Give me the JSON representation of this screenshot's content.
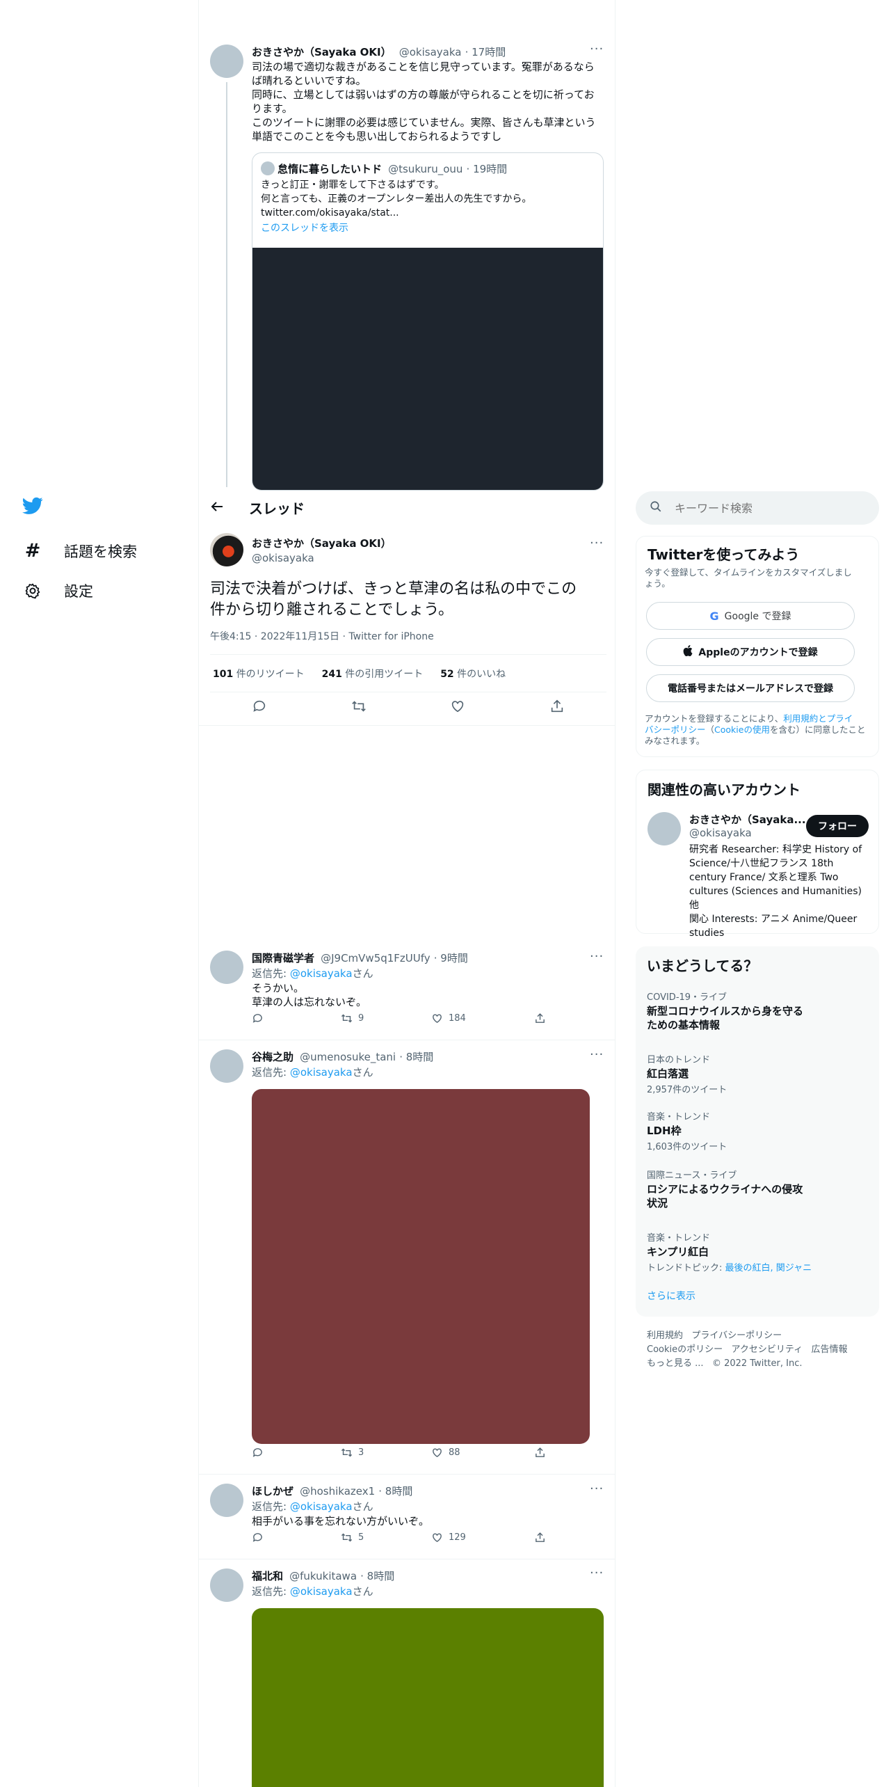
{
  "nav": {
    "explore_label": "話題を検索",
    "settings_label": "設定"
  },
  "top_tweet": {
    "name": "おきさやか（Sayaka OKI）",
    "handle": "@okisayaka",
    "time": "17時間",
    "lines": [
      "司法の場で適切な裁きがあることを信じ見守っています。冤罪があるなら",
      "ば晴れるといいですね。",
      "同時に、立場としては弱いはずの方の尊厳が守られることを切に祈ってお",
      "ります。",
      "このツイートに謝罪の必要は感じていません。実際、皆さんも草津という",
      "単語でこのことを今も思い出しておられるようですし"
    ],
    "quote": {
      "name": "怠惰に暮らしたいトド",
      "handle": "@tsukuru_ouu",
      "time": "19時間",
      "lines": [
        "きっと訂正・謝罪をして下さるはずです。",
        "何と言っても、正義のオープンレター差出人の先生ですから。",
        "twitter.com/okisayaka/stat..."
      ],
      "thread_link": "このスレッドを表示"
    }
  },
  "header": {
    "title": "スレッド"
  },
  "main_tweet": {
    "name": "おきさやか（Sayaka OKI）",
    "handle": "@okisayaka",
    "text_line1": "司法で決着がつけば、きっと草津の名は私の中でこの",
    "text_line2": "件から切り離されることでしょう。",
    "meta": "午後4:15 · 2022年11月15日 · Twitter for iPhone",
    "retweets": "101",
    "retweets_label": "件のリツイート",
    "quotes": "241",
    "quotes_label": "件の引用ツイート",
    "likes": "52",
    "likes_label": "件のいいね"
  },
  "replies": [
    {
      "name": "国際青磁学者",
      "handle": "@J9CmVw5q1FzUUfy",
      "time": "9時間",
      "reply_to": "返信先: ",
      "reply_handle": "@okisayaka",
      "reply_suffix": "さん",
      "line1": "そうかい。",
      "line2": "草津の人は忘れないぞ。",
      "retweets": "9",
      "likes": "184"
    },
    {
      "name": "谷梅之助",
      "handle": "@umenosuke_tani",
      "time": "8時間",
      "reply_to": "返信先: ",
      "reply_handle": "@okisayaka",
      "reply_suffix": "さん",
      "retweets": "3",
      "likes": "88"
    },
    {
      "name": "ほしかぜ",
      "handle": "@hoshikazex1",
      "time": "8時間",
      "reply_to": "返信先: ",
      "reply_handle": "@okisayaka",
      "reply_suffix": "さん",
      "line1": "相手がいる事を忘れない方がいいぞ。",
      "retweets": "5",
      "likes": "129"
    },
    {
      "name": "福北和",
      "handle": "@fukukitawa",
      "time": "8時間",
      "reply_to": "返信先: ",
      "reply_handle": "@okisayaka",
      "reply_suffix": "さん"
    }
  ],
  "search": {
    "placeholder": "キーワード検索"
  },
  "signup": {
    "title": "Twitterを使ってみよう",
    "subtitle_line1": "今すぐ登録して、タイムラインをカスタマイズしまし",
    "subtitle_line2": "ょう。",
    "google": "Google で登録",
    "apple": "Appleのアカウントで登録",
    "phone": "電話番号またはメールアドレスで登録",
    "terms_1": "アカウントを登録することにより、",
    "terms_link1": "利用規約とプライ",
    "terms_link2": "バシーポリシー",
    "terms_2": "（",
    "terms_link3": "Cookieの使用",
    "terms_3": "を含む）に同意したこと",
    "terms_4": "みなされます。"
  },
  "related": {
    "title": "関連性の高いアカウント",
    "name": "おきさやか（Sayaka...",
    "handle": "@okisayaka",
    "follow": "フォロー",
    "bio_lines": [
      "研究者 Researcher: 科学史 History of",
      "Science/十八世紀フランス 18th",
      "century France/ 文系と理系 Two",
      "cultures (Sciences and Humanities) 他",
      "関心 Interests: アニメ Anime/Queer",
      "studies"
    ]
  },
  "trends": {
    "title": "いまどうしてる？",
    "items": [
      {
        "meta": "COVID-19・ライブ",
        "name_line1": "新型コロナウイルスから身を守る",
        "name_line2": "ための基本情報"
      },
      {
        "meta": "日本のトレンド",
        "name_line1": "紅白落選",
        "count": "2,957件のツイート"
      },
      {
        "meta": "音楽・トレンド",
        "name_line1": "LDH枠",
        "count": "1,603件のツイート"
      },
      {
        "meta": "国際ニュース・ライブ",
        "name_line1": "ロシアによるウクライナへの侵攻",
        "name_line2": "状況"
      },
      {
        "meta": "音楽・トレンド",
        "name_line1": "キンプリ紅白",
        "topic_label": "トレンドトピック: ",
        "topic_value": "最後の紅白, 関ジャニ"
      }
    ],
    "show_more": "さらに表示"
  },
  "footer": {
    "terms": "利用規約",
    "privacy": "プライバシーポリシー",
    "cookie": "Cookieのポリシー",
    "accessibility": "アクセシビリティ",
    "ads": "広告情報",
    "more": "もっと見る ...",
    "copyright": "© 2022 Twitter, Inc."
  },
  "colors": {
    "accent": "#1d9bf0",
    "quote_image": "#1e252e",
    "reply2_image": "#7a3a3c",
    "reply4_image": "#5b8000"
  }
}
